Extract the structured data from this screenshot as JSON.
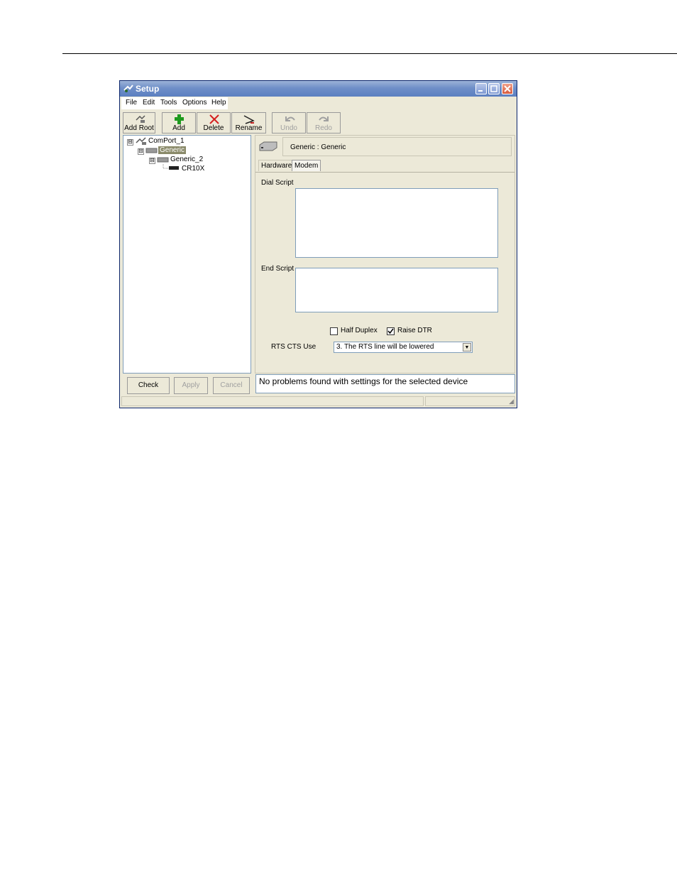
{
  "window": {
    "title": "Setup"
  },
  "menu": {
    "items": [
      "File",
      "Edit",
      "Tools",
      "Options",
      "Help"
    ]
  },
  "toolbar": {
    "buttons": [
      {
        "label": "Add Root",
        "icon": "add-root-icon",
        "enabled": true
      },
      {
        "label": "Add",
        "icon": "plus-icon",
        "enabled": true
      },
      {
        "label": "Delete",
        "icon": "x-icon",
        "enabled": true
      },
      {
        "label": "Rename",
        "icon": "rename-icon",
        "enabled": true
      },
      {
        "label": "Undo",
        "icon": "undo-icon",
        "enabled": false
      },
      {
        "label": "Redo",
        "icon": "redo-icon",
        "enabled": false
      }
    ]
  },
  "tree": {
    "nodes": [
      {
        "label": "ComPort_1",
        "expander": "⊟"
      },
      {
        "label": "Generic",
        "expander": "⊟",
        "selected": true
      },
      {
        "label": "Generic_2",
        "expander": "⊟"
      },
      {
        "label": "CR10X",
        "expander": ""
      }
    ]
  },
  "buttons": {
    "check": "Check",
    "apply": "Apply",
    "cancel": "Cancel"
  },
  "device": {
    "header": "Generic : Generic"
  },
  "tabs": [
    {
      "label": "Hardware",
      "active": false
    },
    {
      "label": "Modem",
      "active": true
    }
  ],
  "modem": {
    "dial_script_label": "Dial Script",
    "dial_script_value": "",
    "end_script_label": "End Script",
    "end_script_value": "",
    "half_duplex_label": "Half Duplex",
    "half_duplex_checked": false,
    "raise_dtr_label": "Raise DTR",
    "raise_dtr_checked": true,
    "rts_cts_label": "RTS CTS Use",
    "rts_cts_value": "3. The RTS line will be lowered"
  },
  "status": {
    "message": "No problems found with settings for the selected device"
  },
  "colors": {
    "titlebar": "#6f8fc8",
    "window_bg": "#ece9d8",
    "selection": "#8a8a6a"
  }
}
